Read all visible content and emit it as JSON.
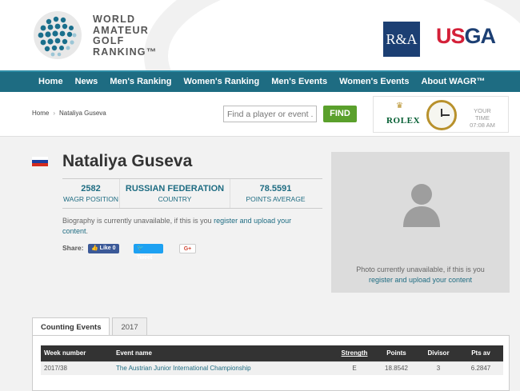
{
  "logo": {
    "line1": "WORLD",
    "line2": "AMATEUR",
    "line3": "GOLF",
    "line4": "RANKING™"
  },
  "partners": {
    "ra": "R&A",
    "usga_red": "US",
    "usga_blue": "GA"
  },
  "nav": [
    "Home",
    "News",
    "Men's Ranking",
    "Women's Ranking",
    "Men's Events",
    "Women's Events",
    "About WAGR™"
  ],
  "breadcrumb": {
    "home": "Home",
    "current": "Nataliya Guseva"
  },
  "search": {
    "placeholder": "Find a player or event ...",
    "button": "FIND"
  },
  "rolex": {
    "brand": "ROLEX",
    "your_time_1": "YOUR TIME",
    "your_time_2": "07:08 AM"
  },
  "player": {
    "name": "Nataliya Guseva",
    "flag_colors": [
      "#ffffff",
      "#1c3f9f",
      "#d52b1e"
    ],
    "stats": [
      {
        "value": "2582",
        "label": "WAGR POSITION"
      },
      {
        "value": "RUSSIAN FEDERATION",
        "label": "COUNTRY"
      },
      {
        "value": "78.5591",
        "label": "POINTS AVERAGE"
      }
    ],
    "bio_pre": "Biography is currently unavailable, if this is you ",
    "bio_link": "register and upload your content",
    "bio_post": "."
  },
  "share": {
    "label": "Share:",
    "facebook": "Like 0",
    "twitter": "Tweet",
    "google": "G+"
  },
  "photo": {
    "text": "Photo currently unavailable, if this is you",
    "link": "register and upload your content"
  },
  "tabs": [
    "Counting Events",
    "2017"
  ],
  "table": {
    "headers": [
      "Week number",
      "Event name",
      "Strength",
      "Points",
      "Divisor",
      "Pts av"
    ],
    "rows": [
      [
        "2017/38",
        "The Austrian Junior International Championship",
        "E",
        "18.8542",
        "3",
        "6.2847"
      ]
    ]
  }
}
